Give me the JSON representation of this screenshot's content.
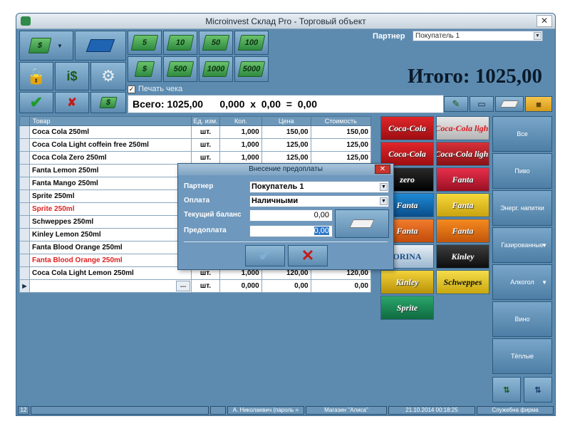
{
  "window": {
    "title": "Microinvest Склад Pro - Торговый объект"
  },
  "partner": {
    "label": "Партнер",
    "value": "Покупатель 1"
  },
  "total": {
    "label": "Итого:",
    "value": "1025,00"
  },
  "print_receipt_label": "Печать чека",
  "money_buttons": [
    "5",
    "10",
    "50",
    "100",
    "500",
    "1000",
    "5000"
  ],
  "summary_line": "Всего: 1025,00      0,000  x  0,00  =  0,00",
  "grid": {
    "headers": [
      "Товар",
      "Ед. изм.",
      "Кол.",
      "Цена",
      "Стоимость"
    ],
    "rows": [
      {
        "name": "Coca Cola 250ml",
        "unit": "шт.",
        "qty": "1,000",
        "price": "150,00",
        "cost": "150,00"
      },
      {
        "name": "Coca Cola Light coffein free 250ml",
        "unit": "шт.",
        "qty": "1,000",
        "price": "125,00",
        "cost": "125,00"
      },
      {
        "name": "Coca Cola Zero 250ml",
        "unit": "шт.",
        "qty": "1,000",
        "price": "125,00",
        "cost": "125,00"
      },
      {
        "name": "Fanta Lemon 250ml",
        "unit": "",
        "qty": "",
        "price": "",
        "cost": ""
      },
      {
        "name": "Fanta Mango 250ml",
        "unit": "",
        "qty": "",
        "price": "",
        "cost": ""
      },
      {
        "name": "Sprite 250ml",
        "unit": "",
        "qty": "",
        "price": "",
        "cost": ""
      },
      {
        "name": "Sprite 250ml",
        "unit": "",
        "qty": "",
        "price": "",
        "cost": ""
      },
      {
        "name": "Schweppes 250ml",
        "unit": "",
        "qty": "",
        "price": "",
        "cost": ""
      },
      {
        "name": "Kinley Lemon 250ml",
        "unit": "",
        "qty": "",
        "price": "",
        "cost": ""
      },
      {
        "name": "Fanta Blood Orange 250ml",
        "unit": "",
        "qty": "",
        "price": "",
        "cost": ""
      },
      {
        "name": "Fanta Blood Orange 250ml",
        "unit": "",
        "qty": "",
        "price": "",
        "cost": ""
      },
      {
        "name": "Coca Cola Light Lemon 250ml",
        "unit": "шт.",
        "qty": "1,000",
        "price": "120,00",
        "cost": "120,00"
      }
    ],
    "new_row": {
      "button": "...",
      "unit": "шт.",
      "qty": "0,000",
      "price": "0,00",
      "cost": "0,00"
    }
  },
  "products": [
    "Coca-Cola",
    "Coca-Cola light",
    "Coca-Cola",
    "Coca-Cola light",
    "zero",
    "Fanta",
    "Fanta",
    "Fanta",
    "Fanta",
    "Fanta",
    "ORINA",
    "Kinley",
    "Kinley",
    "Schweppes",
    "Sprite"
  ],
  "categories": [
    "Все",
    "Пиво",
    "Энерг. напитки",
    "Газированные",
    "Алкогол",
    "Вино",
    "Тёплые"
  ],
  "dialog": {
    "title": "Внесение предоплаты",
    "partner_label": "Партнер",
    "partner_value": "Покупатель 1",
    "payment_label": "Оплата",
    "payment_value": "Наличными",
    "balance_label": "Текущий баланс",
    "balance_value": "0,00",
    "prepay_label": "Предоплата",
    "prepay_value": "0,00"
  },
  "status": {
    "number": "12",
    "user": "А. Николаевич (пароль =",
    "store": "Магазин \"Алиса\"",
    "datetime": "21.10.2014 00:18:25",
    "company": "Служебна фирма"
  }
}
